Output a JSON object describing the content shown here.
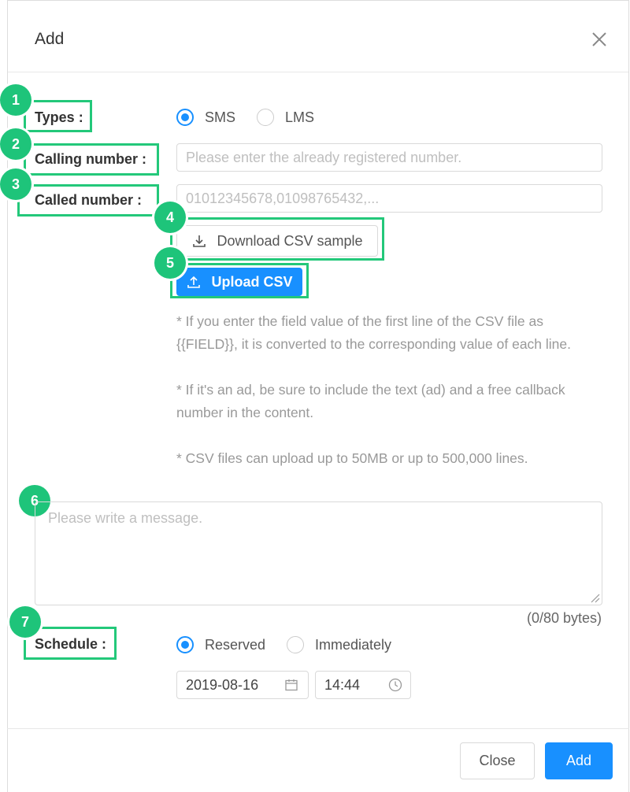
{
  "dialog": {
    "title": "Add"
  },
  "types": {
    "label": "Types :",
    "badge": "1",
    "options": [
      "SMS",
      "LMS"
    ],
    "selected": "SMS"
  },
  "calling_number": {
    "label": "Calling number :",
    "badge": "2",
    "placeholder": "Please enter the already registered number."
  },
  "called_number": {
    "label": "Called number :",
    "badge": "3",
    "placeholder": "01012345678,01098765432,..."
  },
  "download_csv": {
    "label": "Download CSV sample",
    "badge": "4"
  },
  "upload_csv": {
    "label": "Upload CSV",
    "badge": "5"
  },
  "hints": {
    "line1": "* If you enter the field value of the first line of the CSV file as {{FIELD}}, it is converted to the corresponding value of each line.",
    "line2": "* If it's an ad, be sure to include the text (ad) and a free callback number in the content.",
    "line3": "* CSV files can upload up to 50MB or up to 500,000 lines."
  },
  "message": {
    "badge": "6",
    "placeholder": "Please write a message.",
    "byte_count": "(0/80 bytes)"
  },
  "schedule": {
    "label": "Schedule :",
    "badge": "7",
    "options": [
      "Reserved",
      "Immediately"
    ],
    "selected": "Reserved",
    "date": "2019-08-16",
    "time": "14:44"
  },
  "footer": {
    "close_label": "Close",
    "add_label": "Add"
  },
  "colors": {
    "primary": "#1890ff",
    "highlight": "#23c87a",
    "badge": "#1ec47a"
  }
}
